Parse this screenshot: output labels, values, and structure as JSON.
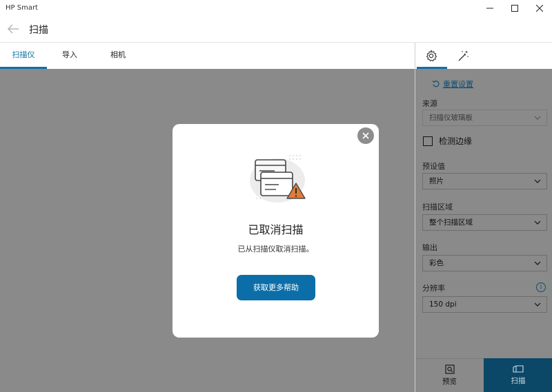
{
  "window": {
    "title": "HP Smart",
    "minimize": "—",
    "maximize": "☐",
    "close": "✕"
  },
  "header": {
    "title": "扫描"
  },
  "tabs": [
    {
      "label": "扫描仪"
    },
    {
      "label": "导入"
    },
    {
      "label": "相机"
    }
  ],
  "panel": {
    "reset_label": "重置设置",
    "source": {
      "label": "来源",
      "value": "扫描仪玻璃板"
    },
    "detect_edges": {
      "label": "检测边缘",
      "checked": false
    },
    "preset": {
      "label": "预设值",
      "value": "照片"
    },
    "area": {
      "label": "扫描区域",
      "value": "整个扫描区域"
    },
    "output": {
      "label": "输出",
      "value": "彩色"
    },
    "resolution": {
      "label": "分辨率",
      "value": "150 dpi",
      "info": "i"
    },
    "preview_button": "预览",
    "scan_button": "扫描"
  },
  "modal": {
    "title": "已取消扫描",
    "message": "已从扫描仪取消扫描。",
    "help_button": "获取更多帮助"
  },
  "colors": {
    "accent": "#0e6fa6",
    "scan_button": "#0b4766",
    "overlay": "#8a8a8a",
    "warning": "#e07b39"
  }
}
